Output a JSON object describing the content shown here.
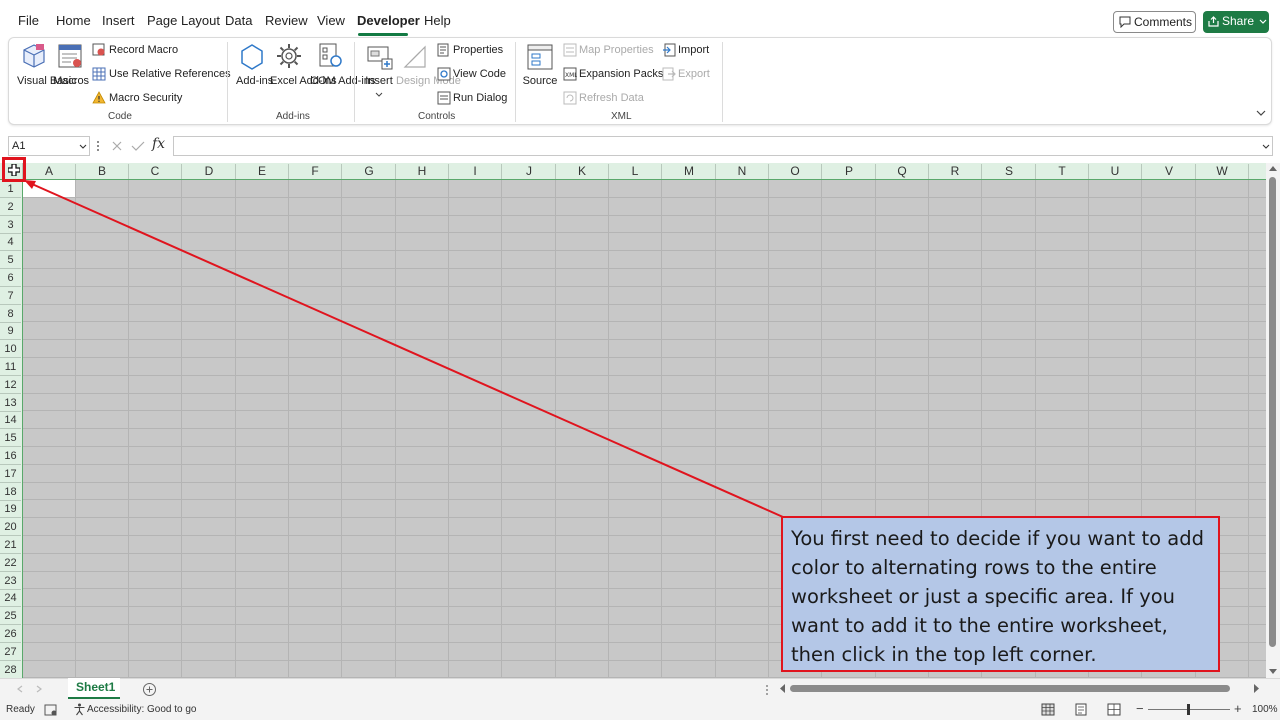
{
  "menu": {
    "items": [
      "File",
      "Home",
      "Insert",
      "Page Layout",
      "Data",
      "Review",
      "View",
      "Developer",
      "Help"
    ],
    "comments_label": "Comments",
    "share_label": "Share"
  },
  "ribbon": {
    "code": {
      "visual_basic": "Visual Basic",
      "macros": "Macros",
      "record_macro": "Record Macro",
      "use_relative": "Use Relative References",
      "macro_security": "Macro Security",
      "group_label": "Code"
    },
    "addins": {
      "addins": "Add-ins",
      "excel_addins": "Excel Add-ins",
      "com_addins": "COM Add-ins",
      "group_label": "Add-ins"
    },
    "controls": {
      "insert": "Insert",
      "design_mode": "Design Mode",
      "properties": "Properties",
      "view_code": "View Code",
      "run_dialog": "Run Dialog",
      "group_label": "Controls"
    },
    "xml": {
      "source": "Source",
      "map_properties": "Map Properties",
      "expansion_packs": "Expansion Packs",
      "refresh_data": "Refresh Data",
      "import": "Import",
      "export": "Export",
      "group_label": "XML"
    }
  },
  "formula_bar": {
    "name_box": "A1",
    "fx": "fx",
    "value": ""
  },
  "grid": {
    "columns": [
      "A",
      "B",
      "C",
      "D",
      "E",
      "F",
      "G",
      "H",
      "I",
      "J",
      "K",
      "L",
      "M",
      "N",
      "O",
      "P",
      "Q",
      "R",
      "S",
      "T",
      "U",
      "V",
      "W"
    ],
    "rows": [
      "1",
      "2",
      "3",
      "4",
      "5",
      "6",
      "7",
      "8",
      "9",
      "10",
      "11",
      "12",
      "13",
      "14",
      "15",
      "16",
      "17",
      "18",
      "19",
      "20",
      "21",
      "22",
      "23",
      "24",
      "25",
      "26",
      "27",
      "28"
    ]
  },
  "sheet_tabs": {
    "active": "Sheet1"
  },
  "status_bar": {
    "ready": "Ready",
    "accessibility": "Accessibility: Good to go",
    "zoom": "100%"
  },
  "callout": {
    "text": "You first need to decide if you want to add color to alternating rows to the entire worksheet or just a specific area. If you want to add it to the entire worksheet, then click in the top left corner."
  },
  "colors": {
    "accent_green": "#1e7b45",
    "header_green": "#dff0e3",
    "callout_fill": "#b4c7e7",
    "annotation_red": "#e0141e"
  }
}
